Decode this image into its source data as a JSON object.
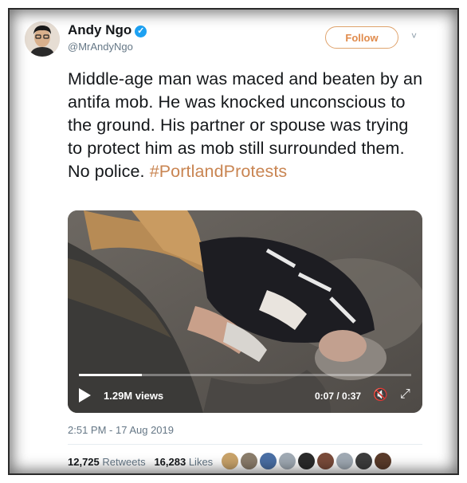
{
  "author": {
    "name": "Andy Ngo",
    "handle": "@MrAndyNgo",
    "verified_icon": "✓"
  },
  "follow_label": "Follow",
  "chevron": "˅",
  "tweet": {
    "text": "Middle-age man was maced and beaten by an antifa mob. He was knocked unconscious to the ground. His partner or spouse was trying to protect him as mob still surrounded them. No police.",
    "hashtag": "#PortlandProtests"
  },
  "video": {
    "views": "1.29M views",
    "time": "0:07 / 0:37",
    "progress_fraction": 0.19,
    "mute_icon": "🔇",
    "expand_icon": "⤢"
  },
  "timestamp": "2:51 PM - 17 Aug 2019",
  "stats": {
    "retweets_count": "12,725",
    "retweets_label": "Retweets",
    "likes_count": "16,283",
    "likes_label": "Likes"
  },
  "likers": [
    {
      "icon": "avatar",
      "color": "#c9a36a"
    },
    {
      "icon": "avatar",
      "color": "#8b7d6b"
    },
    {
      "icon": "avatar",
      "color": "#4a6fa5"
    },
    {
      "icon": "avatar",
      "color": "#a0aab4"
    },
    {
      "icon": "avatar",
      "color": "#2b2b2b"
    },
    {
      "icon": "avatar",
      "color": "#7a4b3a"
    },
    {
      "icon": "avatar",
      "color": "#a0aab4"
    },
    {
      "icon": "avatar",
      "color": "#3d3d3d"
    },
    {
      "icon": "avatar",
      "color": "#5a3b2a"
    }
  ],
  "colors": {
    "hashtag": "#c98552",
    "follow": "#e08b4c",
    "verified": "#1da1f2"
  }
}
